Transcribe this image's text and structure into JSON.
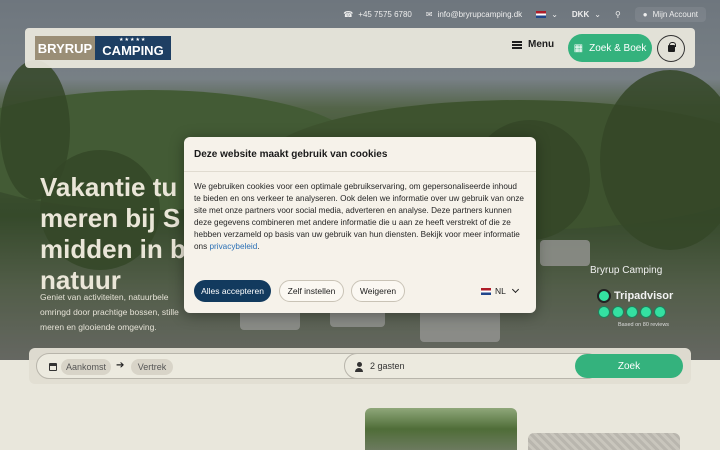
{
  "topbar": {
    "phone": "+45 7575 6780",
    "email": "info@bryrupcamping.dk",
    "currency": "DKK",
    "account": "Mijn Account"
  },
  "header": {
    "logo_left": "BRYRUP",
    "logo_right": "CAMPING",
    "logo_stars": "★★★★★",
    "menu_label": "Menu",
    "book_label": "Zoek & Boek"
  },
  "hero": {
    "title": "Vakantie tu meren bij S midden in b natuur",
    "subtitle": "Geniet van activiteiten, natuurbele omringd door prachtige bossen, stille meren en glooiende omgeving."
  },
  "tripadvisor": {
    "name": "Bryrup Camping",
    "brand": "Tripadvisor",
    "rating": 5,
    "reviews": "Based on 80 reviews"
  },
  "booking": {
    "arrival": "Aankomst",
    "departure": "Vertrek",
    "guests": "2 gasten",
    "search": "Zoek"
  },
  "cookie": {
    "title": "Deze website maakt gebruik van cookies",
    "body": "We gebruiken cookies voor een optimale gebruikservaring, om gepersonaliseerde inhoud te bieden en ons verkeer te analyseren. Ook delen we informatie over uw gebruik van onze site met onze partners voor social media, adverteren en analyse. Deze partners kunnen deze gegevens combineren met andere informatie die u aan ze heeft verstrekt of die ze hebben verzameld op basis van uw gebruik van hun diensten. Bekijk voor meer informatie ons ",
    "link": "privacybeleid",
    "after_link": ".",
    "accept": "Alles accepteren",
    "own": "Zelf instellen",
    "refuse": "Weigeren",
    "language": "NL"
  },
  "colors": {
    "accent_green": "#34b27d",
    "navy": "#123a5e",
    "link": "#2a6fb5"
  }
}
